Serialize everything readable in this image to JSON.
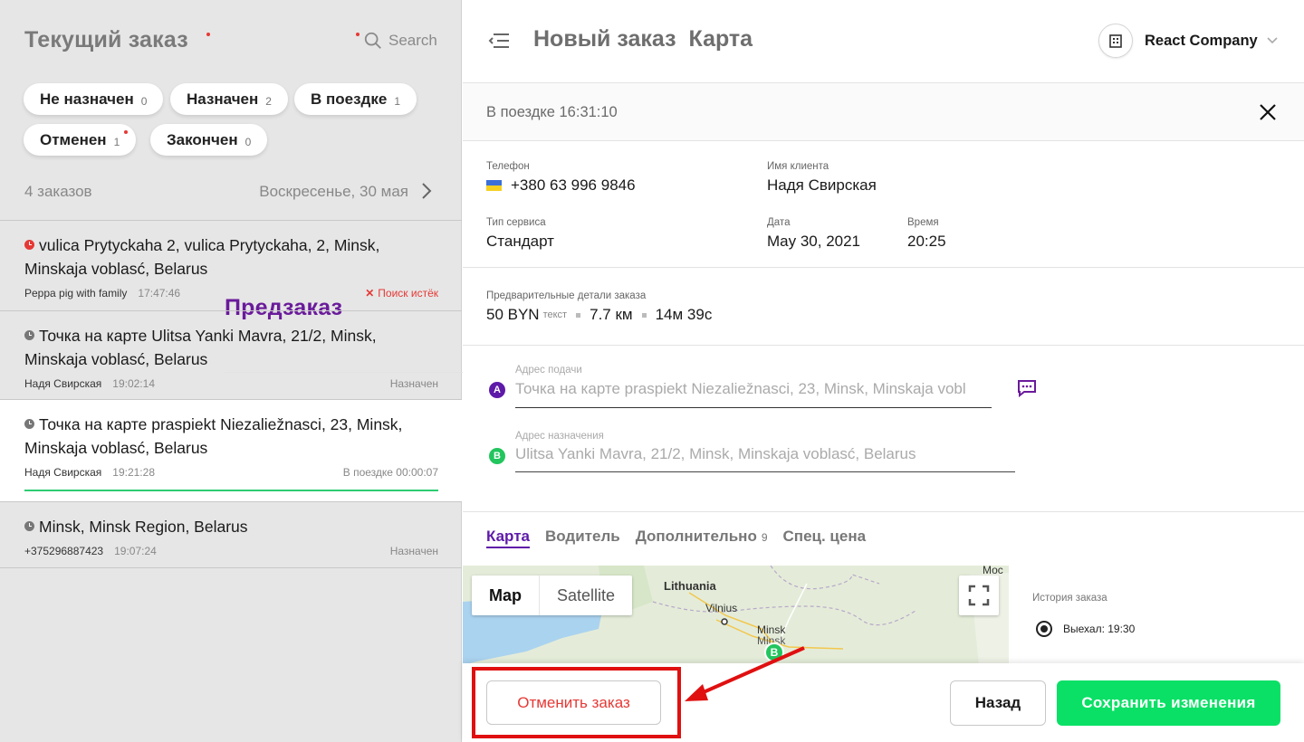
{
  "left": {
    "tab_current": "Текущий заказ",
    "tab_preorder": "Предзаказ",
    "search_label": "Search",
    "chips": [
      {
        "label": "Не назначен",
        "count": "0"
      },
      {
        "label": "Назначен",
        "count": "2"
      },
      {
        "label": "В поездке",
        "count": "1"
      },
      {
        "label": "Отменен",
        "count": "1"
      },
      {
        "label": "Закончен",
        "count": "0"
      }
    ],
    "count_text": "4 заказов",
    "date_text": "Воскресенье, 30 мая",
    "orders": [
      {
        "address": "vulica Prytyckaha 2, vulica Prytyckaha, 2, Minsk, Minskaja voblasć, Belarus",
        "client": "Peppa pig with family",
        "time": "17:47:46",
        "status": "Поиск истёк"
      },
      {
        "address": "Точка на карте Ulitsa Yanki Mavra, 21/2, Minsk, Minskaja voblasć, Belarus",
        "client": "Надя Свирская",
        "time": "19:02:14",
        "status": "Назначен"
      },
      {
        "address": "Точка на карте praspiekt Niezaliežnasci, 23, Minsk, Minskaja voblasć, Belarus",
        "client": "Надя Свирская",
        "time": "19:21:28",
        "status": "В поездке 00:00:07"
      },
      {
        "address": "Minsk, Minsk Region, Belarus",
        "client": "+375296887423",
        "time": "19:07:24",
        "status": "Назначен"
      }
    ]
  },
  "header": {
    "title_new": "Новый заказ",
    "title_map": "Карта",
    "company": "React Company"
  },
  "status_line": "В поездке 16:31:10",
  "info": {
    "phone_label": "Телефон",
    "phone": "+380 63 996 9846",
    "client_label": "Имя клиента",
    "client": "Надя Свирская",
    "service_label": "Тип сервиса",
    "service": "Стандарт",
    "date_label": "Дата",
    "date": "May 30, 2021",
    "time_label": "Время",
    "time": "20:25"
  },
  "pre_details": {
    "label": "Предварительные детали заказа",
    "price": "50 BYN",
    "price_note": "текст",
    "distance": "7.7 км",
    "duration": "14м 39с"
  },
  "addresses": {
    "pickup_label": "Адрес подачи",
    "pickup": "Точка на карте praspiekt Niezaliežnasci, 23, Minsk, Minskaja vobl",
    "dest_label": "Адрес назначения",
    "dest": "Ulitsa Yanki Mavra, 21/2, Minsk, Minskaja voblasć, Belarus",
    "badge_a": "A",
    "badge_b": "B"
  },
  "tabs": [
    {
      "label": "Карта"
    },
    {
      "label": "Водитель"
    },
    {
      "label": "Дополнительно",
      "count": "9"
    },
    {
      "label": "Спец. цена"
    }
  ],
  "map": {
    "mode_map": "Map",
    "mode_satellite": "Satellite",
    "label_lithuania": "Lithuania",
    "label_vilnius": "Vilnius",
    "label_minsk1": "Minsk",
    "label_minsk2": "Minsk",
    "label_mosc": "Мос",
    "pin": "B"
  },
  "history": {
    "label": "История заказа",
    "item": "Выехал: 19:30"
  },
  "footer": {
    "cancel": "Отменить заказ",
    "back": "Назад",
    "save": "Сохранить изменения"
  },
  "colors": {
    "accent": "#6a1b9a",
    "save": "#0ae066",
    "danger": "#e53935",
    "highlight": "#e01010"
  }
}
